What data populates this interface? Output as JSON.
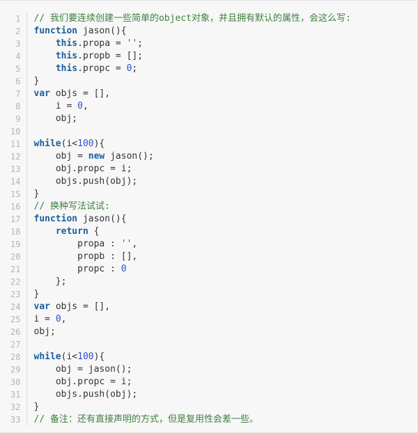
{
  "editor": {
    "language": "javascript",
    "colors": {
      "background": "#f7f7f7",
      "gutter_text": "#b4b4b4",
      "gutter_border": "#dcdcdc",
      "block_border": "#e3e3e3",
      "comment": "#3f7f3f",
      "keyword": "#1b5e9e",
      "string": "#2f4fcf",
      "number": "#2f4fcf",
      "plain": "#333333"
    },
    "first_line_number": 1,
    "total_lines": 33,
    "lines": [
      {
        "n": "1",
        "text": "// 我们要连续创建一些简单的object对象，并且拥有默认的属性，会这么写:"
      },
      {
        "n": "2",
        "text": "function jason(){"
      },
      {
        "n": "3",
        "text": "    this.propa = '';"
      },
      {
        "n": "4",
        "text": "    this.propb = [];"
      },
      {
        "n": "5",
        "text": "    this.propc = 0;"
      },
      {
        "n": "6",
        "text": "}"
      },
      {
        "n": "7",
        "text": "var objs = [],"
      },
      {
        "n": "8",
        "text": "    i = 0,"
      },
      {
        "n": "9",
        "text": "    obj;"
      },
      {
        "n": "10",
        "text": ""
      },
      {
        "n": "11",
        "text": "while(i<100){"
      },
      {
        "n": "12",
        "text": "    obj = new jason();"
      },
      {
        "n": "13",
        "text": "    obj.propc = i;"
      },
      {
        "n": "14",
        "text": "    objs.push(obj);"
      },
      {
        "n": "15",
        "text": "}"
      },
      {
        "n": "16",
        "text": "// 换种写法试试:"
      },
      {
        "n": "17",
        "text": "function jason(){"
      },
      {
        "n": "18",
        "text": "    return {"
      },
      {
        "n": "19",
        "text": "        propa : '',"
      },
      {
        "n": "20",
        "text": "        propb : [],"
      },
      {
        "n": "21",
        "text": "        propc : 0"
      },
      {
        "n": "22",
        "text": "    };"
      },
      {
        "n": "23",
        "text": "}"
      },
      {
        "n": "24",
        "text": "var objs = [],"
      },
      {
        "n": "25",
        "text": "i = 0,"
      },
      {
        "n": "26",
        "text": "obj;"
      },
      {
        "n": "27",
        "text": ""
      },
      {
        "n": "28",
        "text": "while(i<100){"
      },
      {
        "n": "29",
        "text": "    obj = jason();"
      },
      {
        "n": "30",
        "text": "    obj.propc = i;"
      },
      {
        "n": "31",
        "text": "    objs.push(obj);"
      },
      {
        "n": "32",
        "text": "}"
      },
      {
        "n": "33",
        "text": "// 备注：还有直接声明的方式，但是复用性会差一些。"
      }
    ],
    "tokens": {
      "keywords": [
        "function",
        "this",
        "var",
        "while",
        "new",
        "return"
      ],
      "comment_prefix": "//"
    }
  }
}
